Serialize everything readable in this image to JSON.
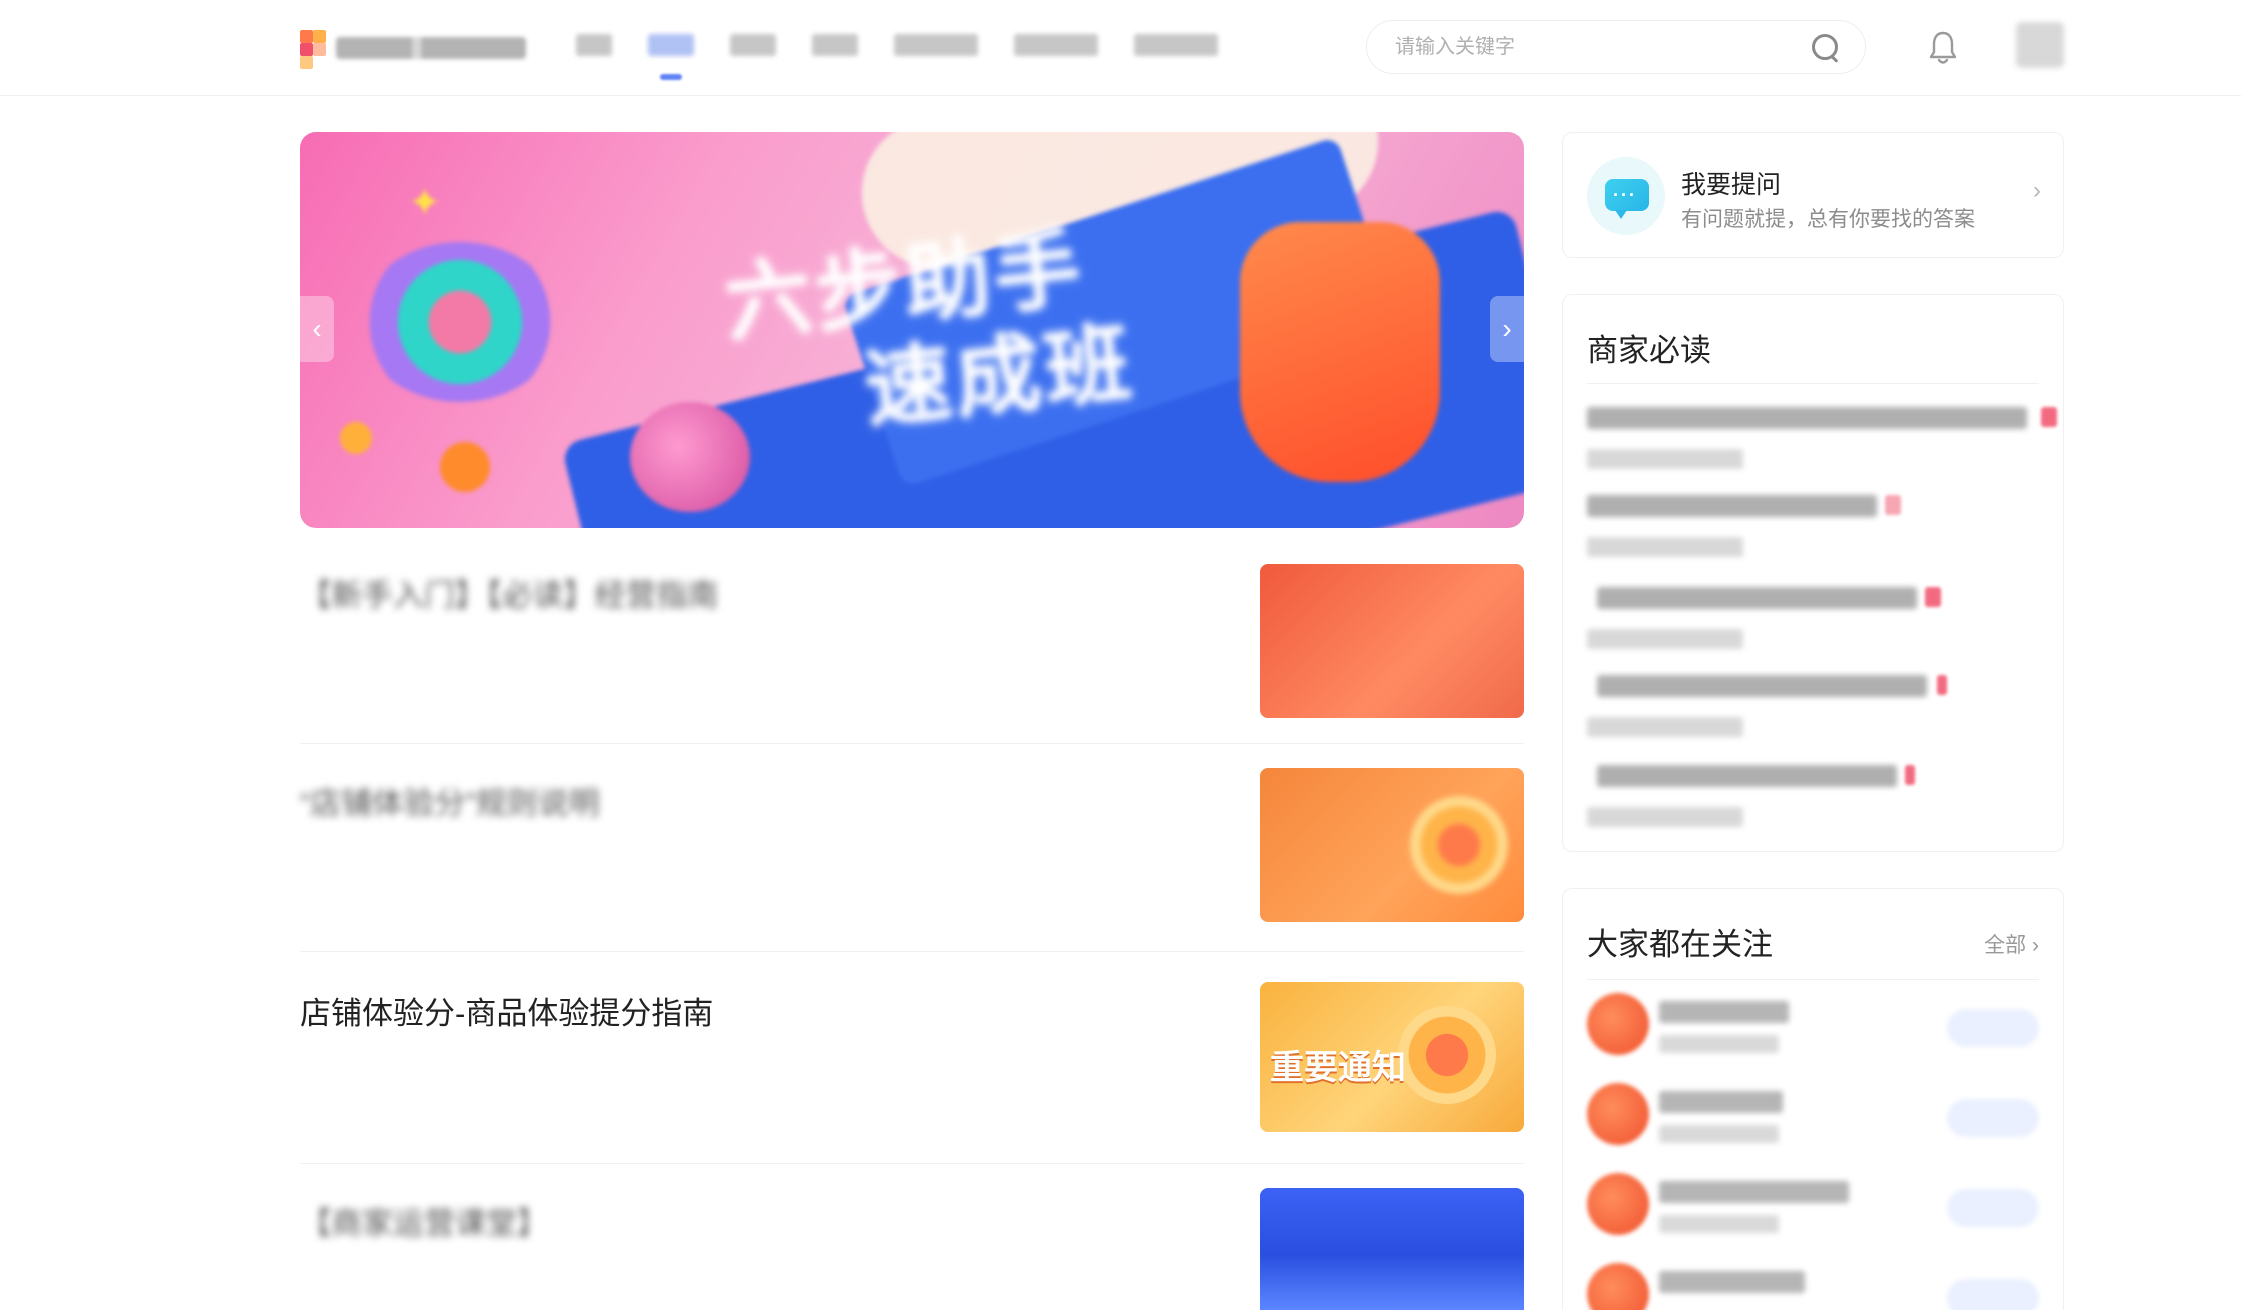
{
  "header": {
    "site_name": "",
    "nav": [
      {
        "label": "",
        "active": false
      },
      {
        "label": "",
        "active": true
      },
      {
        "label": "",
        "active": false
      },
      {
        "label": "",
        "active": false
      },
      {
        "label": "",
        "active": false
      },
      {
        "label": "",
        "active": false
      },
      {
        "label": "",
        "active": false
      }
    ],
    "search": {
      "placeholder": "请输入关键字",
      "icon": "search-icon"
    },
    "notification_icon": "bell-icon",
    "accent_color": "#5f83f5"
  },
  "banner": {
    "title_line1": "六步助手",
    "title_line2": "速成班",
    "prev_label": "‹",
    "next_label": "›"
  },
  "articles": [
    {
      "title": "【新手入门】【必读】经营指南",
      "meta": "",
      "thumb_text": "",
      "thumb_style": "red"
    },
    {
      "title": "“店铺体验分”规则说明",
      "meta": "",
      "thumb_text": "",
      "thumb_style": "orange"
    },
    {
      "title": "店铺体验分-商品体验提分指南",
      "meta": "",
      "thumb_text": "重要通知",
      "thumb_style": "gold"
    },
    {
      "title": "【商家运营课堂】",
      "meta": "",
      "thumb_text": "",
      "thumb_style": "blue"
    }
  ],
  "sidebar": {
    "ask": {
      "title": "我要提问",
      "subtitle": "有问题就提，总有你要找的答案",
      "arrow": "›"
    },
    "must_read": {
      "title": "商家必读",
      "items": [
        {
          "title": "",
          "date": ""
        },
        {
          "title": "",
          "date": ""
        },
        {
          "title": "",
          "date": ""
        },
        {
          "title": "",
          "date": ""
        },
        {
          "title": "",
          "date": ""
        }
      ]
    },
    "follow": {
      "title": "大家都在关注",
      "more_label": "全部",
      "more_arrow": "›",
      "items": [
        {
          "name": "",
          "sub": "",
          "button": ""
        },
        {
          "name": "",
          "sub": "",
          "button": ""
        },
        {
          "name": "",
          "sub": "",
          "button": ""
        },
        {
          "name": "",
          "sub": "",
          "button": ""
        }
      ]
    }
  }
}
